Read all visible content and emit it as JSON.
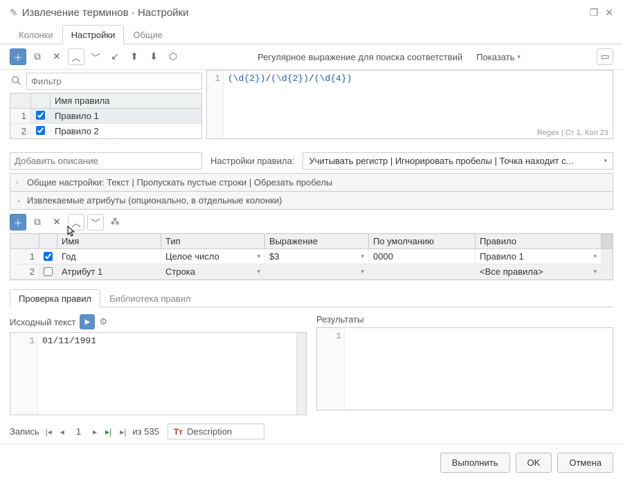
{
  "title": "Извлечение терминов · Настройки",
  "main_tabs": {
    "columns": "Колонки",
    "settings": "Настройки",
    "general": "Общие"
  },
  "filter_placeholder": "Фильтр",
  "rules_header": "Имя правила",
  "rules": [
    {
      "idx": "1",
      "name": "Правило 1",
      "checked": true
    },
    {
      "idx": "2",
      "name": "Правило 2",
      "checked": true
    }
  ],
  "regex_label": "Регулярное выражение для поиска соответствий",
  "show_label": "Показать",
  "regex_line": "1",
  "regex_groups": {
    "g1": "(\\d{2})",
    "g2": "(\\d{2})",
    "g3": "(\\d{4})"
  },
  "regex_status": "Regex | Ст 1, Кол 23",
  "desc_placeholder": "Добавить описание",
  "rule_settings_label": "Настройки правила:",
  "rule_settings_text": "Учитывать регистр | Игнорировать пробелы | Точка находит с...",
  "acc_general": "Общие настройки: Текст | Пропускать пустые строки | Обрезать пробелы",
  "acc_attrs": "Извлекаемые атрибуты (опционально, в отдельные колонки)",
  "attr_headers": {
    "name": "Имя",
    "type": "Тип",
    "expr": "Выражение",
    "def": "По умолчанию",
    "rule": "Правило"
  },
  "attr_rows": [
    {
      "idx": "1",
      "checked": true,
      "name": "Год",
      "type": "Целое число",
      "expr": "$3",
      "def": "0000",
      "rule": "Правило 1"
    },
    {
      "idx": "2",
      "checked": false,
      "name": "Атрибут 1",
      "type": "Строка",
      "expr": "",
      "def": "",
      "rule": "<Все правила>"
    }
  ],
  "sub_tabs": {
    "test": "Проверка правил",
    "library": "Библиотека правил"
  },
  "source_label": "Исходный текст",
  "results_label": "Результаты",
  "source_line_num": "1",
  "source_text": "01/11/1991",
  "result_line_num": "1",
  "record_label": "Запись",
  "record_current": "1",
  "record_total": "из 535",
  "record_field": "Description",
  "footer": {
    "run": "Выполнить",
    "ok": "OK",
    "cancel": "Отмена"
  }
}
